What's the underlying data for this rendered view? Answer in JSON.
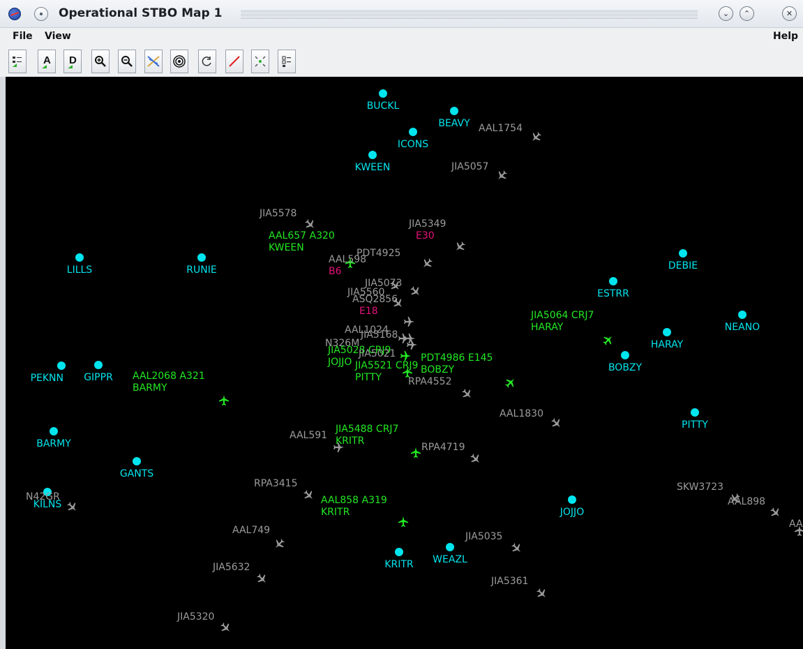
{
  "window": {
    "title": "Operational STBO Map 1",
    "logo_icon": "nasa-logo-icon",
    "buttons": {
      "minimize": "⌄",
      "maximize": "⌃",
      "close": "✕"
    }
  },
  "menubar": {
    "file": "File",
    "view": "View",
    "help": "Help"
  },
  "toolbar": {
    "buttons": [
      {
        "name": "settings-tool-button",
        "icon": "list-settings-icon"
      },
      {
        "name": "arrival-tool-button",
        "icon": "arrival-a-icon"
      },
      {
        "name": "departure-tool-button",
        "icon": "departure-d-icon"
      },
      {
        "name": "zoom-in-button",
        "icon": "zoom-in-icon"
      },
      {
        "name": "zoom-out-button",
        "icon": "zoom-out-icon"
      },
      {
        "name": "crossing-routes-button",
        "icon": "crossing-routes-icon"
      },
      {
        "name": "range-rings-button",
        "icon": "range-rings-icon"
      },
      {
        "name": "refresh-button",
        "icon": "refresh-icon"
      },
      {
        "name": "draw-line-button",
        "icon": "draw-line-icon"
      },
      {
        "name": "center-view-button",
        "icon": "center-view-icon"
      },
      {
        "name": "options-list-button",
        "icon": "options-list-icon"
      }
    ]
  },
  "colors": {
    "fix": "#00e5ee",
    "aircraft_gray": "#9c9c9c",
    "aircraft_green": "#23e823",
    "gate": "#e8127a",
    "background": "#000000"
  },
  "fixes": [
    {
      "name": "BUCKL"
    },
    {
      "name": "BEAVY"
    },
    {
      "name": "ICONS"
    },
    {
      "name": "KWEEN"
    },
    {
      "name": "LILLS"
    },
    {
      "name": "RUNIE"
    },
    {
      "name": "DEBIE"
    },
    {
      "name": "ESTRR"
    },
    {
      "name": "NEANO"
    },
    {
      "name": "HARAY"
    },
    {
      "name": "BOBZY"
    },
    {
      "name": "PEKNN"
    },
    {
      "name": "GIPPR"
    },
    {
      "name": "BARMY"
    },
    {
      "name": "GANTS"
    },
    {
      "name": "KILNS"
    },
    {
      "name": "PITTY"
    },
    {
      "name": "JOJJO"
    },
    {
      "name": "KRITR"
    },
    {
      "name": "WEAZL"
    }
  ],
  "aircraft": [
    {
      "callsign": "AAL1754",
      "status": "gray"
    },
    {
      "callsign": "JIA5057",
      "status": "gray"
    },
    {
      "callsign": "JIA5578",
      "status": "gray"
    },
    {
      "callsign": "JIA5349",
      "gate": "E30",
      "status": "gray"
    },
    {
      "callsign": "AAL657 A320",
      "dest": "KWEEN",
      "status": "green"
    },
    {
      "callsign": "AAL598",
      "gate": "B6",
      "status": "gray"
    },
    {
      "callsign": "PDT4925",
      "status": "gray"
    },
    {
      "callsign": "JIA5073",
      "status": "gray"
    },
    {
      "callsign": "JIA5560",
      "status": "gray"
    },
    {
      "callsign": "ASQ2856",
      "gate": "E18",
      "status": "gray"
    },
    {
      "callsign": "AAL1024",
      "status": "gray"
    },
    {
      "callsign": "JIA5168",
      "status": "gray"
    },
    {
      "callsign": "N326M",
      "status": "gray"
    },
    {
      "callsign": "JIA5028 CRJ9",
      "dest": "JOJJO",
      "status": "green"
    },
    {
      "callsign": "JIA5021",
      "status": "gray"
    },
    {
      "callsign": "JIA5521 CRJ9",
      "dest": "PITTY",
      "status": "green"
    },
    {
      "callsign": "PDT4986 E145",
      "dest": "BOBZY",
      "status": "green"
    },
    {
      "callsign": "RPA4552",
      "status": "gray"
    },
    {
      "callsign": "JIA5064 CRJ7",
      "dest": "HARAY",
      "status": "green"
    },
    {
      "callsign": "AAL2068 A321",
      "dest": "BARMY",
      "status": "green"
    },
    {
      "callsign": "AAL1830",
      "status": "gray"
    },
    {
      "callsign": "AAL591",
      "status": "gray"
    },
    {
      "callsign": "JIA5488 CRJ7",
      "dest": "KRITR",
      "status": "green"
    },
    {
      "callsign": "RPA4719",
      "status": "gray"
    },
    {
      "callsign": "RPA3415",
      "status": "gray"
    },
    {
      "callsign": "AAL858 A319",
      "dest": "KRITR",
      "status": "green"
    },
    {
      "callsign": "N42GR",
      "status": "gray"
    },
    {
      "callsign": "SKW3723",
      "status": "gray"
    },
    {
      "callsign": "AAL898",
      "status": "gray"
    },
    {
      "callsign": "AA",
      "status": "gray"
    },
    {
      "callsign": "AAL749",
      "status": "gray"
    },
    {
      "callsign": "JIA5035",
      "status": "gray"
    },
    {
      "callsign": "JIA5632",
      "status": "gray"
    },
    {
      "callsign": "JIA5361",
      "status": "gray"
    },
    {
      "callsign": "JIA5320",
      "status": "gray"
    }
  ]
}
